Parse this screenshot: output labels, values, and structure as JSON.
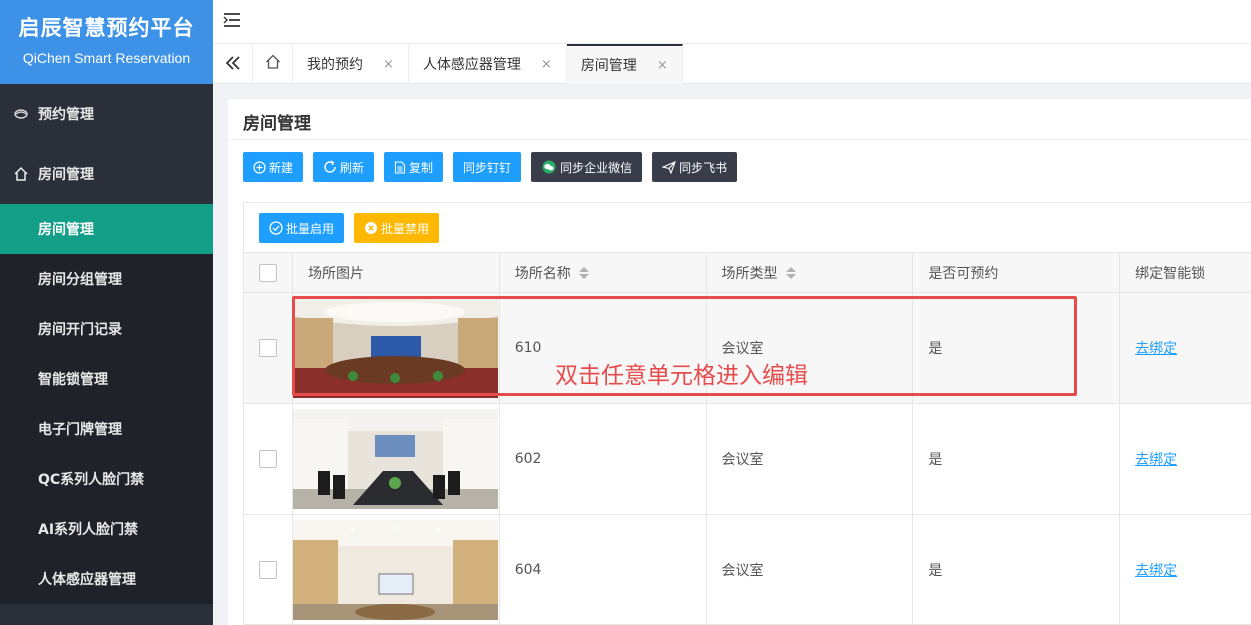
{
  "brand": {
    "title": "启辰智慧预约平台",
    "subtitle": "QiChen Smart Reservation"
  },
  "sidebar": {
    "groups": [
      {
        "label": "预约管理",
        "icon": "reservation-icon"
      },
      {
        "label": "房间管理",
        "icon": "home-icon"
      }
    ],
    "items": [
      {
        "label": "房间管理",
        "active": true
      },
      {
        "label": "房间分组管理"
      },
      {
        "label": "房间开门记录"
      },
      {
        "label": "智能锁管理"
      },
      {
        "label": "电子门牌管理"
      },
      {
        "label": "QC系列人脸门禁"
      },
      {
        "label": "AI系列人脸门禁"
      },
      {
        "label": "人体感应器管理"
      }
    ]
  },
  "tabs": [
    {
      "label": "我的预约",
      "close": "×"
    },
    {
      "label": "人体感应器管理",
      "close": "×"
    },
    {
      "label": "房间管理",
      "close": "×",
      "active": true
    }
  ],
  "page": {
    "title": "房间管理"
  },
  "toolbar": {
    "new": "新建",
    "refresh": "刷新",
    "copy": "复制",
    "sync_dingtalk": "同步钉钉",
    "sync_wecom": "同步企业微信",
    "sync_feishu": "同步飞书"
  },
  "table_tools": {
    "batch_enable": "批量启用",
    "batch_disable": "批量禁用"
  },
  "table": {
    "columns": [
      "场所图片",
      "场所名称",
      "场所类型",
      "是否可预约",
      "绑定智能锁"
    ],
    "rows": [
      {
        "name": "610",
        "type": "会议室",
        "bookable": "是",
        "lock": "去绑定"
      },
      {
        "name": "602",
        "type": "会议室",
        "bookable": "是",
        "lock": "去绑定"
      },
      {
        "name": "604",
        "type": "会议室",
        "bookable": "是",
        "lock": "去绑定"
      }
    ]
  },
  "annotation": "双击任意单元格进入编辑",
  "colors": {
    "brand": "#3d92e8",
    "sidebar": "#2b2f3a",
    "active_menu": "#139e88",
    "primary": "#1e9fff",
    "dark_button": "#393d49",
    "warning": "#ffb800",
    "annotation": "#e74c4c"
  }
}
